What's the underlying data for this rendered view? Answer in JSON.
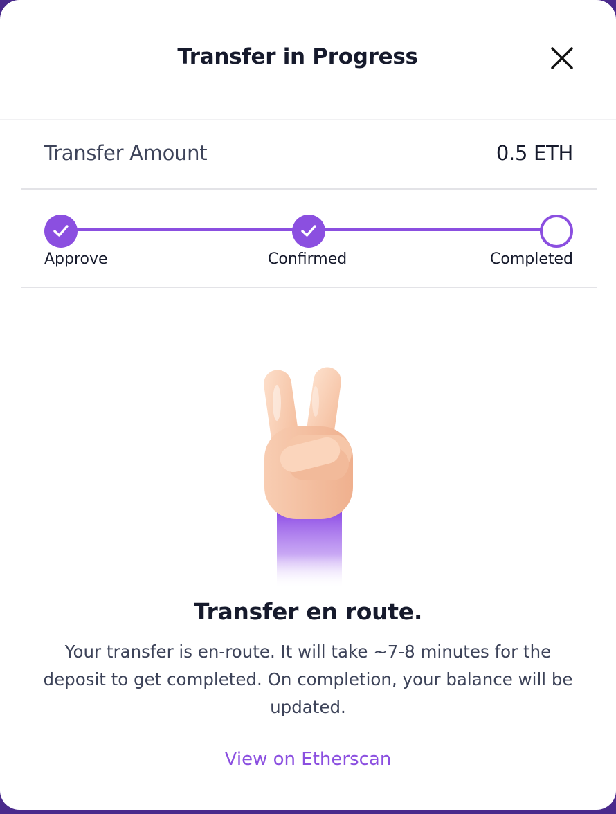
{
  "header": {
    "title": "Transfer in Progress",
    "close_icon": "close-icon"
  },
  "amount": {
    "label": "Transfer Amount",
    "value": "0.5 ETH"
  },
  "stepper": {
    "steps": [
      {
        "label": "Approve",
        "status": "completed"
      },
      {
        "label": "Confirmed",
        "status": "completed"
      },
      {
        "label": "Completed",
        "status": "pending"
      }
    ]
  },
  "illustration": {
    "icon": "victory-hand-icon"
  },
  "message": {
    "title": "Transfer en route.",
    "body": "Your transfer is en-route. It will take ~7-8 minutes for the deposit to get completed. On completion, your balance will be updated."
  },
  "link": {
    "label": "View on Etherscan"
  },
  "colors": {
    "accent": "#8b4fe0",
    "text_primary": "#161a2c",
    "text_secondary": "#3d4359",
    "backdrop": "#4a2a8c"
  }
}
